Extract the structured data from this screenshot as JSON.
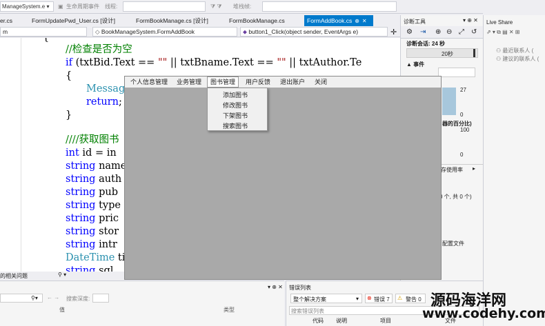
{
  "toolbar": {
    "project_combo": "ManageSystem.e",
    "lifecycle_label": "生命周期事件",
    "thread_label": "线程:",
    "stack_label": "堆栈帧:"
  },
  "tabs": [
    {
      "label": "er.cs"
    },
    {
      "label": "FormUpdatePwd_User.cs [设计]"
    },
    {
      "label": "FormBookManage.cs [设计]"
    },
    {
      "label": "FormBookManage.cs"
    },
    {
      "label": "FormAddBook.cs",
      "close": "✕"
    }
  ],
  "nav": {
    "scope": "m",
    "class_name": "BookManageSystem.FormAddBook",
    "method_name": "button1_Click(object sender, EventArgs e)"
  },
  "code": {
    "brace_open": "{",
    "comment1": "//检查是否为空",
    "if_kw": "if",
    "cond_a": " (txtBid.Text == ",
    "cond_str1": "\"\"",
    "cond_b": " || txtBname.Text == ",
    "cond_str2": "\"\"",
    "cond_c": " || txtAuthor.Te",
    "brace_inner_open": "{",
    "message": "Message",
    "return_kw": "return",
    "return_semi": ";",
    "brace_inner_close": "}",
    "comment2": "////获取图书",
    "int_kw": "int",
    "int_rest": " id = in",
    "string_kw": "string",
    "v_name": " name",
    "v_auth": " auth",
    "v_pub": " pub",
    "v_type": " type",
    "v_pric": " pric",
    "v_stor": " stor",
    "v_intr": " intr",
    "datetime_kw": "DateTime",
    "v_ti": " ti",
    "v_sql": " sql"
  },
  "diag": {
    "title": "诊断工具",
    "session_label": "诊断会话: 24 秒",
    "time_label": "20秒",
    "events_label": "事件",
    "val_27": "27",
    "val_0a": "0",
    "cpu_label": "器的百分比)",
    "val_100": "100",
    "val_0b": "0",
    "mem_label": "存使用率",
    "count_label": "0 个, 共 0 个)",
    "config_label": "配置文件"
  },
  "live_share": {
    "title": "Live Share",
    "recent": "最近联系人 (",
    "suggested": "建议的联系人 ("
  },
  "form": {
    "menu": [
      {
        "label": "个人信息管理"
      },
      {
        "label": "业务管理"
      },
      {
        "label": "图书管理"
      },
      {
        "label": "用户反馈"
      },
      {
        "label": "退出账户"
      },
      {
        "label": "关闭"
      }
    ],
    "dropdown": [
      {
        "label": "添加图书"
      },
      {
        "label": "修改图书"
      },
      {
        "label": "下架图书"
      },
      {
        "label": "搜索图书"
      }
    ]
  },
  "bottom_left": {
    "tab_label": "的相关问题",
    "search_depth": "搜索深度:",
    "col_value": "值",
    "col_type": "类型"
  },
  "bottom_right": {
    "title": "错误列表",
    "scope": "整个解决方案",
    "errors": "错误 7",
    "warnings": "警告 0",
    "search": "搜索错误列表",
    "col_code": "代码",
    "col_desc": "说明",
    "col_project": "项目",
    "col_file": "文件"
  },
  "watermark": {
    "line1": "源码海洋网",
    "line2": "www.codehy.com"
  }
}
